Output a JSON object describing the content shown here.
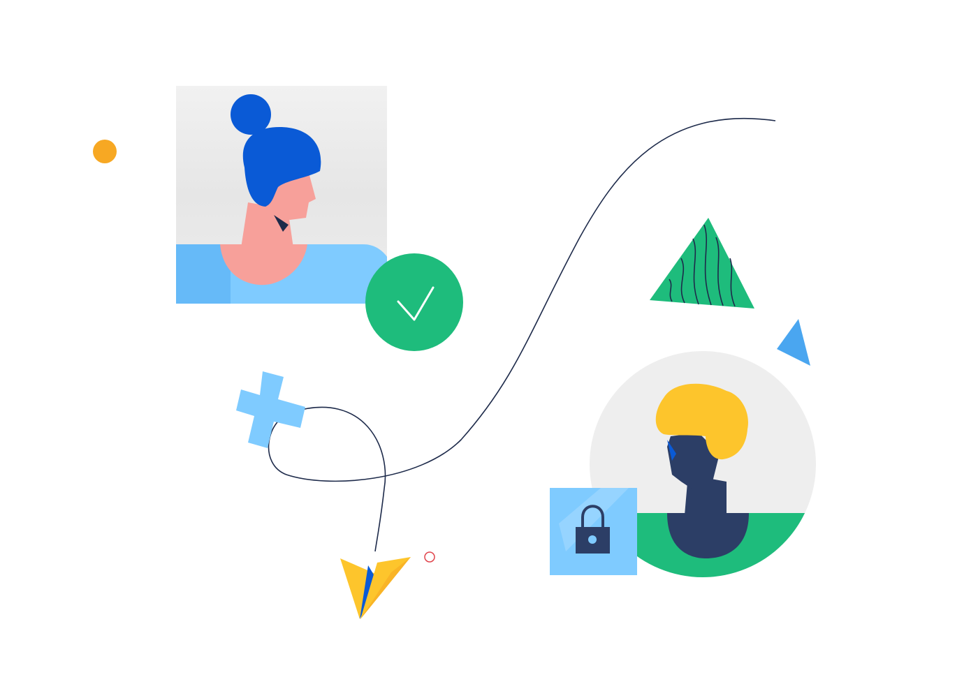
{
  "colors": {
    "background": "#ffffff",
    "panel_gray": "#eeeeee",
    "panel_gray_light": "#f3f3f3",
    "blue_dark": "#0a5ad6",
    "blue_light": "#7fcbff",
    "blue_sky": "#4aa6f0",
    "skin_pink": "#f7a09a",
    "skin_navy": "#2c3e66",
    "green": "#1ebc7c",
    "green_dark": "#0a9e5e",
    "yellow": "#fdc52c",
    "orange": "#f7a823",
    "line_navy": "#1d2a4a",
    "red_ring": "#e0434b",
    "tooth": "#1d2a4a"
  },
  "icons": {
    "woman_avatar": "woman-portrait-illustration",
    "man_avatar": "man-portrait-illustration",
    "verified": "check-icon",
    "lock": "lock-icon",
    "plus": "plus-icon",
    "paper_plane": "paper-plane-icon",
    "green_triangle": "triangle-icon",
    "blue_triangle": "triangle-icon",
    "orange_dot": "dot-icon",
    "red_ring": "ring-icon"
  }
}
